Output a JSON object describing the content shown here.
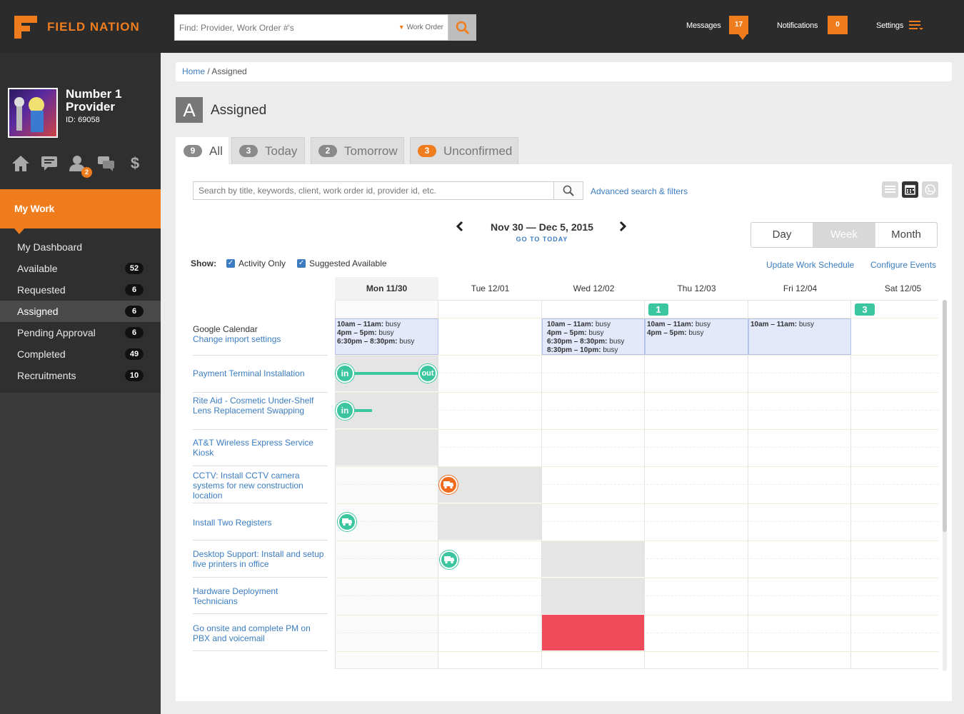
{
  "brand": {
    "name": "FIELD NATION"
  },
  "topbar": {
    "search_placeholder": "Find: Provider, Work Order #'s",
    "search_scope": "Work Order",
    "messages_label": "Messages",
    "messages_count": "17",
    "notifications_label": "Notifications",
    "notifications_count": "0",
    "settings_label": "Settings"
  },
  "profile": {
    "name": "Number 1 Provider",
    "id_label": "ID: 69058",
    "icon_badge": "2"
  },
  "sidebar": {
    "section": "My Work",
    "items": [
      {
        "label": "My Dashboard",
        "count": ""
      },
      {
        "label": "Available",
        "count": "52"
      },
      {
        "label": "Requested",
        "count": "6"
      },
      {
        "label": "Assigned",
        "count": "6"
      },
      {
        "label": "Pending Approval",
        "count": "6"
      },
      {
        "label": "Completed",
        "count": "49"
      },
      {
        "label": "Recruitments",
        "count": "10"
      }
    ]
  },
  "breadcrumb": {
    "home": "Home",
    "sep": " / ",
    "current": "Assigned"
  },
  "page": {
    "icon_letter": "A",
    "title": "Assigned"
  },
  "tabs": [
    {
      "count": "9",
      "label": "All"
    },
    {
      "count": "3",
      "label": "Today"
    },
    {
      "count": "2",
      "label": "Tomorrow"
    },
    {
      "count": "3",
      "label": "Unconfirmed"
    }
  ],
  "filters": {
    "search_placeholder": "Search by title, keywords, client, work order id, provider id, etc.",
    "advanced_link": "Advanced search & filters",
    "show_label": "Show:",
    "activity_only": "Activity Only",
    "suggested_available": "Suggested Available",
    "update_schedule": "Update Work Schedule",
    "configure_events": "Configure Events"
  },
  "calendar": {
    "range": "Nov 30 — Dec 5, 2015",
    "go_today": "GO TO TODAY",
    "views": [
      "Day",
      "Week",
      "Month"
    ],
    "days": [
      "Mon 11/30",
      "Tue 12/01",
      "Wed 12/02",
      "Thu 12/03",
      "Fri 12/04",
      "Sat 12/05"
    ],
    "day_badges": {
      "thu": "1",
      "sat": "3"
    },
    "google": {
      "title": "Google Calendar",
      "link": "Change import settings"
    },
    "busy": {
      "mon": [
        [
          "10am – 11am:",
          " busy"
        ],
        [
          "4pm – 5pm:",
          " busy"
        ],
        [
          "6:30pm – 8:30pm:",
          " busy"
        ]
      ],
      "wed": [
        [
          "10am – 11am:",
          " busy"
        ],
        [
          "4pm – 5pm:",
          " busy"
        ],
        [
          "6:30pm – 8:30pm:",
          " busy"
        ],
        [
          "8:30pm – 10pm:",
          " busy"
        ]
      ],
      "thu": [
        [
          "10am – 11am:",
          " busy"
        ],
        [
          "4pm – 5pm:",
          " busy"
        ]
      ],
      "fri": [
        [
          "10am – 11am:",
          " busy"
        ]
      ]
    },
    "work_orders": [
      "Payment Terminal Installation",
      "Rite Aid - Cosmetic Under-Shelf Lens Replacement Swapping",
      "AT&T Wireless Express Service Kiosk",
      "CCTV: Install CCTV camera systems for new construction location",
      "Install Two Registers",
      "Desktop Support: Install and setup five printers in office",
      "Hardware Deployment Technicians",
      "Go onsite and complete PM on PBX and voicemail"
    ],
    "pin_in": "in",
    "pin_out": "out"
  },
  "colors": {
    "accent": "#f07d1d",
    "teal": "#3cc6a0",
    "link": "#3b7dc0",
    "alert": "#ef4b5a"
  }
}
